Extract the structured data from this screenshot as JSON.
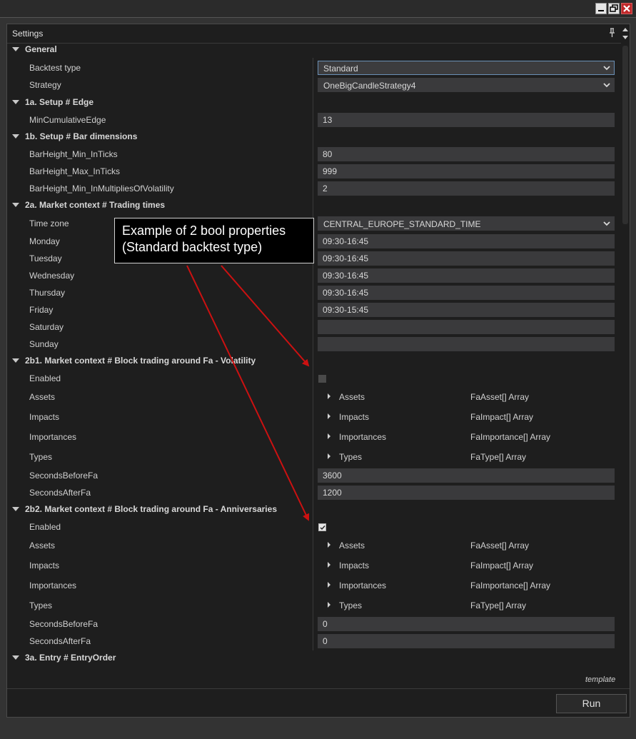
{
  "panel": {
    "title": "Settings"
  },
  "general": {
    "title": "General",
    "backtest_type": {
      "label": "Backtest type",
      "value": "Standard"
    },
    "strategy": {
      "label": "Strategy",
      "value": "OneBigCandleStrategy4"
    }
  },
  "edge": {
    "title": "1a. Setup # Edge",
    "min_cumulative_edge": {
      "label": "MinCumulativeEdge",
      "value": "13"
    }
  },
  "bar_dims": {
    "title": "1b. Setup # Bar dimensions",
    "min_ticks": {
      "label": "BarHeight_Min_InTicks",
      "value": "80"
    },
    "max_ticks": {
      "label": "BarHeight_Max_InTicks",
      "value": "999"
    },
    "min_vol": {
      "label": "BarHeight_Min_InMultipliesOfVolatility",
      "value": "2"
    }
  },
  "trading_times": {
    "title": "2a. Market context # Trading times",
    "time_zone": {
      "label": "Time zone",
      "value": "CENTRAL_EUROPE_STANDARD_TIME"
    },
    "days": [
      {
        "label": "Monday",
        "value": "09:30-16:45"
      },
      {
        "label": "Tuesday",
        "value": "09:30-16:45"
      },
      {
        "label": "Wednesday",
        "value": "09:30-16:45"
      },
      {
        "label": "Thursday",
        "value": "09:30-16:45"
      },
      {
        "label": "Friday",
        "value": "09:30-15:45"
      },
      {
        "label": "Saturday",
        "value": ""
      },
      {
        "label": "Sunday",
        "value": ""
      }
    ]
  },
  "volatility": {
    "title": "2b1. Market context # Block trading around Fa - Volatility",
    "enabled": {
      "label": "Enabled",
      "checked": false
    },
    "arrays": [
      {
        "label": "Assets",
        "name": "Assets",
        "type": "FaAsset[] Array"
      },
      {
        "label": "Impacts",
        "name": "Impacts",
        "type": "FaImpact[] Array"
      },
      {
        "label": "Importances",
        "name": "Importances",
        "type": "FaImportance[] Array"
      },
      {
        "label": "Types",
        "name": "Types",
        "type": "FaType[] Array"
      }
    ],
    "seconds_before": {
      "label": "SecondsBeforeFa",
      "value": "3600"
    },
    "seconds_after": {
      "label": "SecondsAfterFa",
      "value": "1200"
    }
  },
  "anniversaries": {
    "title": "2b2. Market context # Block trading around Fa - Anniversaries",
    "enabled": {
      "label": "Enabled",
      "checked": true
    },
    "arrays": [
      {
        "label": "Assets",
        "name": "Assets",
        "type": "FaAsset[] Array"
      },
      {
        "label": "Impacts",
        "name": "Impacts",
        "type": "FaImpact[] Array"
      },
      {
        "label": "Importances",
        "name": "Importances",
        "type": "FaImportance[] Array"
      },
      {
        "label": "Types",
        "name": "Types",
        "type": "FaType[] Array"
      }
    ],
    "seconds_before": {
      "label": "SecondsBeforeFa",
      "value": "0"
    },
    "seconds_after": {
      "label": "SecondsAfterFa",
      "value": "0"
    }
  },
  "entry": {
    "title": "3a. Entry # EntryOrder"
  },
  "footer": {
    "template_label": "template",
    "run_label": "Run"
  },
  "callout": {
    "line1": "Example of 2 bool properties",
    "line2": "(Standard backtest type)"
  },
  "colors": {
    "annotation_arrow": "#cc1111",
    "close_button": "#c0282a",
    "focus_border": "#6a8fb5"
  }
}
